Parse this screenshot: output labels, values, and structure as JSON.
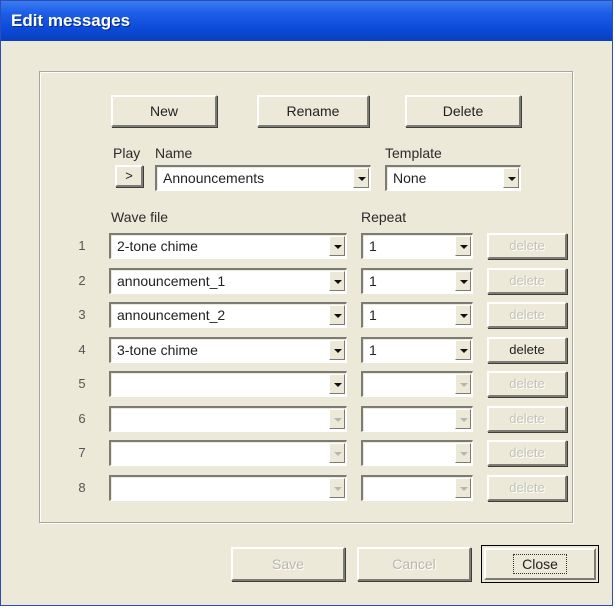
{
  "window": {
    "title": "Edit messages"
  },
  "toolbar": {
    "new_label": "New",
    "rename_label": "Rename",
    "delete_label": "Delete"
  },
  "header": {
    "play_label": "Play",
    "play_button": ">",
    "name_label": "Name",
    "name_value": "Announcements",
    "template_label": "Template",
    "template_value": "None"
  },
  "table": {
    "wave_label": "Wave file",
    "repeat_label": "Repeat",
    "rows": [
      {
        "num": "1",
        "wave": "2-tone chime",
        "repeat": "1",
        "delete": "delete",
        "enabled": true,
        "delete_enabled": false
      },
      {
        "num": "2",
        "wave": "announcement_1",
        "repeat": "1",
        "delete": "delete",
        "enabled": true,
        "delete_enabled": false
      },
      {
        "num": "3",
        "wave": "announcement_2",
        "repeat": "1",
        "delete": "delete",
        "enabled": true,
        "delete_enabled": false
      },
      {
        "num": "4",
        "wave": "3-tone chime",
        "repeat": "1",
        "delete": "delete",
        "enabled": true,
        "delete_enabled": true
      },
      {
        "num": "5",
        "wave": "",
        "repeat": "",
        "delete": "delete",
        "enabled": true,
        "delete_enabled": false
      },
      {
        "num": "6",
        "wave": "",
        "repeat": "",
        "delete": "delete",
        "enabled": false,
        "delete_enabled": false
      },
      {
        "num": "7",
        "wave": "",
        "repeat": "",
        "delete": "delete",
        "enabled": false,
        "delete_enabled": false
      },
      {
        "num": "8",
        "wave": "",
        "repeat": "",
        "delete": "delete",
        "enabled": false,
        "delete_enabled": false
      }
    ]
  },
  "footer": {
    "save_label": "Save",
    "cancel_label": "Cancel",
    "close_label": "Close"
  }
}
